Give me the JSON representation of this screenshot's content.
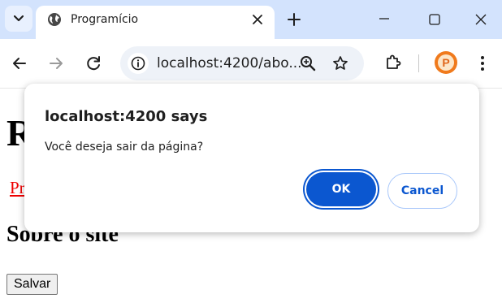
{
  "browser": {
    "tab": {
      "title": "Programício",
      "favicon": "globe-icon"
    },
    "omnibox": {
      "url": "localhost:4200/abo..."
    },
    "profile": {
      "initial": "P",
      "color": "#f07a1c"
    },
    "icons": [
      "tab-search-icon",
      "globe-icon",
      "close-icon",
      "plus-icon",
      "minimize-icon",
      "maximize-icon",
      "window-close-icon",
      "back-icon",
      "forward-icon",
      "reload-icon",
      "site-info-icon",
      "zoom-icon",
      "star-icon",
      "extensions-icon",
      "more-vert-icon"
    ],
    "colors": {
      "tabstrip": "#d3e3fd",
      "omnibox": "#eef2f8",
      "accent": "#0b57d0"
    }
  },
  "page": {
    "heading": "R",
    "link": "Pr",
    "subheading": "Sobre o site",
    "save_button": "Salvar",
    "link_color": "#ee0000"
  },
  "dialog": {
    "title": "localhost:4200 says",
    "message": "Você deseja sair da página?",
    "ok_label": "OK",
    "cancel_label": "Cancel"
  }
}
